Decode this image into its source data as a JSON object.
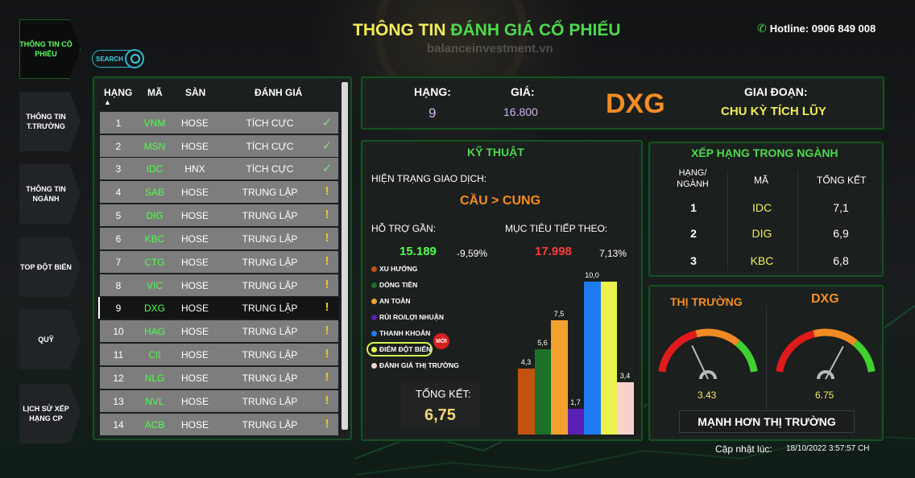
{
  "header": {
    "title_part1": "THÔNG TIN ",
    "title_part2": "ĐÁNH GIÁ CỔ PHIẾU",
    "watermark": "balanceinvestment.vn",
    "hotline": "Hotline: 0906 849 008"
  },
  "nav": [
    {
      "label": "THÔNG TIN CỔ PHIẾU",
      "active": true
    },
    {
      "label": "THÔNG TIN T.TRƯỜNG",
      "active": false
    },
    {
      "label": "THÔNG TIN NGÀNH",
      "active": false
    },
    {
      "label": "TOP ĐỘT BIẾN",
      "active": false
    },
    {
      "label": "QUỸ",
      "active": false
    },
    {
      "label": "LỊCH SỬ XẾP HẠNG CP",
      "active": false
    }
  ],
  "search": {
    "label": "SEARCH"
  },
  "table": {
    "headers": [
      "HẠNG",
      "MÃ",
      "SÀN",
      "ĐÁNH GIÁ"
    ],
    "rows": [
      {
        "rank": "1",
        "code": "VNM",
        "exchange": "HOSE",
        "rating": "TÍCH CỰC",
        "icon": "check-icon"
      },
      {
        "rank": "2",
        "code": "MSN",
        "exchange": "HOSE",
        "rating": "TÍCH CỰC",
        "icon": "check-icon"
      },
      {
        "rank": "3",
        "code": "IDC",
        "exchange": "HNX",
        "rating": "TÍCH CỰC",
        "icon": "check-icon"
      },
      {
        "rank": "4",
        "code": "SAB",
        "exchange": "HOSE",
        "rating": "TRUNG LẬP",
        "icon": "exclamation-icon"
      },
      {
        "rank": "5",
        "code": "DIG",
        "exchange": "HOSE",
        "rating": "TRUNG LẬP",
        "icon": "exclamation-icon"
      },
      {
        "rank": "6",
        "code": "KBC",
        "exchange": "HOSE",
        "rating": "TRUNG LẬP",
        "icon": "exclamation-icon"
      },
      {
        "rank": "7",
        "code": "CTG",
        "exchange": "HOSE",
        "rating": "TRUNG LẬP",
        "icon": "exclamation-icon"
      },
      {
        "rank": "8",
        "code": "VIC",
        "exchange": "HOSE",
        "rating": "TRUNG LẬP",
        "icon": "exclamation-icon"
      },
      {
        "rank": "9",
        "code": "DXG",
        "exchange": "HOSE",
        "rating": "TRUNG LẬP",
        "icon": "exclamation-icon",
        "selected": true
      },
      {
        "rank": "10",
        "code": "HAG",
        "exchange": "HOSE",
        "rating": "TRUNG LẬP",
        "icon": "exclamation-icon"
      },
      {
        "rank": "11",
        "code": "CII",
        "exchange": "HOSE",
        "rating": "TRUNG LẬP",
        "icon": "exclamation-icon"
      },
      {
        "rank": "12",
        "code": "NLG",
        "exchange": "HOSE",
        "rating": "TRUNG LẬP",
        "icon": "exclamation-icon"
      },
      {
        "rank": "13",
        "code": "NVL",
        "exchange": "HOSE",
        "rating": "TRUNG LẬP",
        "icon": "exclamation-icon"
      },
      {
        "rank": "14",
        "code": "ACB",
        "exchange": "HOSE",
        "rating": "TRUNG LẬP",
        "icon": "exclamation-icon"
      }
    ]
  },
  "summary": {
    "rank_label": "HẠNG:",
    "rank_value": "9",
    "price_label": "GIÁ:",
    "price_value": "16.800",
    "ticker": "DXG",
    "phase_label": "GIAI ĐOẠN:",
    "phase_value": "CHU KỲ TÍCH LŨY"
  },
  "technical": {
    "title": "KỸ THUẬT",
    "status_label": "HIỆN TRẠNG GIAO DỊCH:",
    "status_value": "CẦU > CUNG",
    "support_label": "HỖ TRỢ GẦN:",
    "support_value": "15.189",
    "support_pct": "-9,59%",
    "target_label": "MỤC TIÊU TIẾP THEO:",
    "target_value": "17.998",
    "target_pct": "7,13%",
    "total_label": "TỔNG KẾT:",
    "total_value": "6,75",
    "new_badge": "MỚI"
  },
  "chart_data": {
    "type": "bar",
    "categories": [
      "XU HƯỚNG",
      "DÒNG TIỀN",
      "AN TOÀN",
      "RỦI RO/LỢI NHUẬN",
      "THANH KHOẢN",
      "ĐIỂM ĐỘT BIẾN",
      "ĐÁNH GIÁ THỊ TRƯỜNG"
    ],
    "values": [
      4.3,
      5.6,
      7.5,
      1.7,
      10.0,
      10.0,
      3.4
    ],
    "value_labels": [
      "4,3",
      "5,6",
      "7,5",
      "1,7",
      "10,0",
      "",
      "3,4"
    ],
    "colors": [
      "#c0530f",
      "#1e6f2a",
      "#f3a12e",
      "#5a1fb4",
      "#1f7cf0",
      "#e9f24e",
      "#f7d2cc"
    ],
    "ylim": [
      0,
      10
    ],
    "legend": "left"
  },
  "ranking": {
    "title": "XẾP HẠNG TRONG NGÀNH",
    "headers": [
      "HẠNG/ NGÀNH",
      "MÃ",
      "TỔNG KẾT"
    ],
    "rows": [
      {
        "rank": "1",
        "code": "IDC",
        "score": "7,1"
      },
      {
        "rank": "2",
        "code": "DIG",
        "score": "6,9"
      },
      {
        "rank": "3",
        "code": "KBC",
        "score": "6,8"
      }
    ]
  },
  "gauges": {
    "market_label": "THỊ TRƯỜNG",
    "market_value": "3.43",
    "market_level": 3.43,
    "stock_label": "DXG",
    "stock_value": "6.75",
    "stock_level": 6.75,
    "max": 10,
    "verdict": "MẠNH HƠN THỊ TRƯỜNG"
  },
  "footer": {
    "updated_label": "Cập nhật lúc:",
    "updated_value": "18/10/2022 3:57:57 CH"
  }
}
